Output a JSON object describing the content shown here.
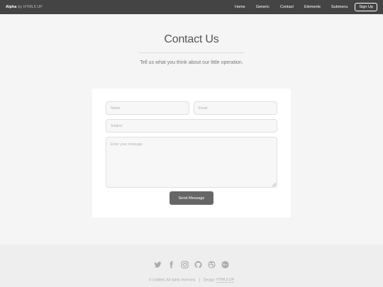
{
  "header": {
    "brand_name": "Alpha",
    "brand_by": "by HTML5 UP",
    "nav": [
      "Home",
      "Generic",
      "Contact",
      "Elements",
      "Submenu"
    ],
    "signup_label": "Sign Up"
  },
  "hero": {
    "title": "Contact Us",
    "subtitle": "Tell us what you think about our little operation."
  },
  "form": {
    "name_placeholder": "Name",
    "email_placeholder": "Email",
    "subject_placeholder": "Subject",
    "message_placeholder": "Enter your message",
    "send_label": "Send Message"
  },
  "footer": {
    "icons": [
      "twitter-icon",
      "facebook-icon",
      "instagram-icon",
      "github-icon",
      "dribbble-icon",
      "google-plus-icon"
    ],
    "copyright": "© Untitled. All rights reserved.",
    "design_label": "Design:",
    "design_link": "HTML5 UP"
  },
  "colors": {
    "topbar": "#444444",
    "background": "#f5f5f5",
    "button": "#666666",
    "footer": "#eeeeee"
  }
}
